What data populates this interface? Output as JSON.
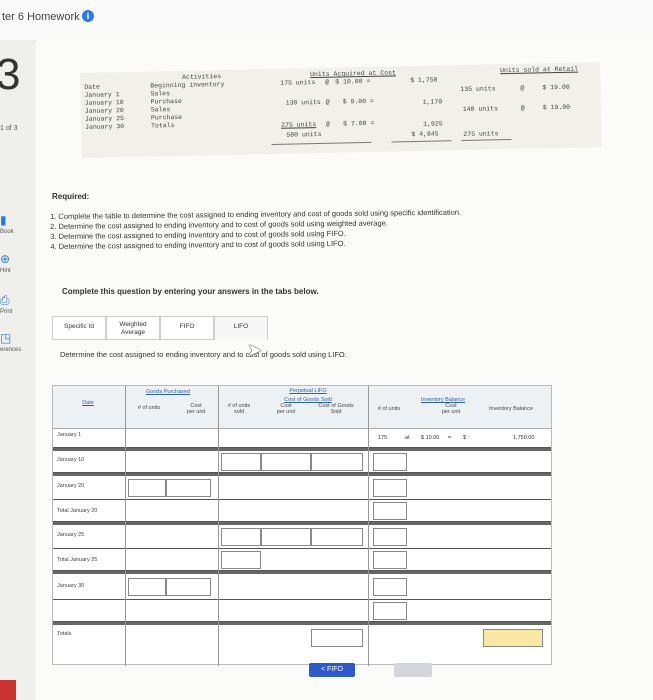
{
  "header": {
    "title": "ter 6 Homework",
    "info_icon": "i"
  },
  "question": {
    "number": "3",
    "position": "1 of 3"
  },
  "rail": {
    "book": "Book",
    "hint": "Hint",
    "print": "Print",
    "references": "erences"
  },
  "given": {
    "headers": {
      "activities": "Activities",
      "units_acquired": "Units Acquired at Cost",
      "units_sold": "Units sold at Retail"
    },
    "date_col": "Date\nJanuary 1\nJanuary 10\nJanuary 20\nJanuary 25\nJanuary 30",
    "activity_col": "Beginning inventory\nSales\nPurchase\nSales\nPurchase\nTotals",
    "acq_units": [
      "175 units",
      "130 units",
      "275 units",
      "580 units"
    ],
    "acq_cost": [
      "$ 10.00 =",
      "$ 9.00 =",
      "$ 7.00 ="
    ],
    "acq_total": [
      "$ 1,750",
      "1,170",
      "1,925",
      "$ 4,845"
    ],
    "sold_units": [
      "135 units",
      "140 units",
      "275 units"
    ],
    "sold_at": [
      "@",
      "@"
    ],
    "sold_price": [
      "$ 19.00",
      "$ 19.00"
    ],
    "at_signs": [
      "@",
      "@",
      "@"
    ]
  },
  "required": {
    "label": "Required:",
    "items": [
      "1. Complete the table to determine the cost assigned to ending inventory and cost of goods sold using specific identification.",
      "2. Determine the cost assigned to ending inventory and to cost of goods sold using weighted average.",
      "3. Determine the cost assigned to ending inventory and to cost of goods sold using FIFO.",
      "4. Determine the cost assigned to ending inventory and to cost of goods sold using LIFO."
    ]
  },
  "complete_text": "Complete this question by entering your answers in the tabs below.",
  "tabs": [
    "Specific Id",
    "Weighted\nAverage",
    "FIFO",
    "LIFO"
  ],
  "determine_text": "Determine the cost assigned to ending inventory and to cost of goods sold using LIFO.",
  "grid": {
    "perpetual": "Perpetual LIFO",
    "goods_purchased": "Goods Purchased",
    "cogs": "Cost of Goods Sold",
    "inv_balance": "Inventory Balance",
    "date": "Date",
    "units": "# of units",
    "cost_per_unit": "Cost\nper unit",
    "units_sold": "# of units\nsold",
    "cogs_sold": "Cost of Goods\nSold",
    "inv_units": "# of units",
    "inventory_balance": "Inventory Balance",
    "rows": [
      "January 1",
      "January 10",
      "January 20",
      "Total January 20",
      "January 25",
      "Total January 25",
      "January 30",
      "Totals"
    ],
    "jan1": {
      "units": "175",
      "at": "at",
      "cost": "$ 10.00",
      "eq": "=",
      "dollar": "$",
      "balance": "1,750.00"
    }
  },
  "buttons": {
    "prev": "< FIFO",
    "next": "LIFO >"
  }
}
